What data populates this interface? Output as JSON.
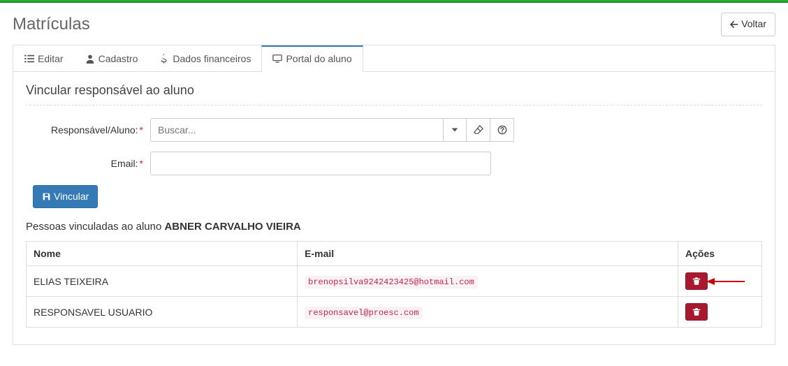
{
  "header": {
    "title": "Matrículas",
    "back_label": "Voltar"
  },
  "tabs": {
    "edit": "Editar",
    "register": "Cadastro",
    "finance": "Dados financeiros",
    "portal": "Portal do aluno"
  },
  "portal": {
    "section_title": "Vincular responsável ao aluno",
    "responsible_label": "Responsável/Aluno:",
    "responsible_placeholder": "Buscar...",
    "email_label": "Email:",
    "link_button": "Vincular",
    "linked_heading_prefix": "Pessoas vinculadas ao aluno ",
    "student_name": "ABNER CARVALHO VIEIRA",
    "table": {
      "col_name": "Nome",
      "col_email": "E-mail",
      "col_actions": "Ações",
      "rows": [
        {
          "name": "ELIAS TEIXEIRA",
          "email": "brenopsilva9242423425@hotmail.com"
        },
        {
          "name": "RESPONSAVEL USUARIO",
          "email": "responsavel@proesc.com"
        }
      ]
    }
  },
  "icons": {
    "back_arrow": "arrow-left-icon",
    "list": "list-icon",
    "user": "user-icon",
    "dollar": "dollar-icon",
    "monitor": "monitor-icon",
    "chevron_down": "chevron-down-icon",
    "eraser": "eraser-icon",
    "help": "help-icon",
    "save": "save-icon",
    "trash": "trash-icon"
  },
  "colors": {
    "top_accent": "#26b72b",
    "primary": "#337ab7",
    "danger": "#a6192e",
    "code_text": "#c7254e",
    "annotation_arrow": "#d40000"
  }
}
